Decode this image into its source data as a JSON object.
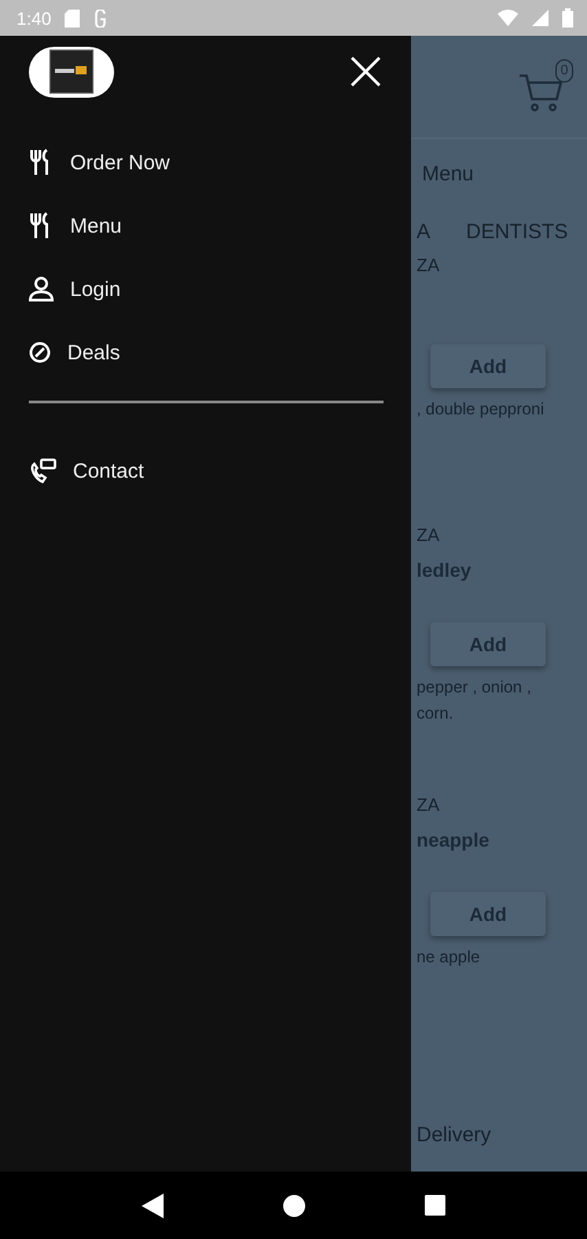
{
  "status_bar": {
    "time": "1:40"
  },
  "drawer": {
    "sections": [
      [
        {
          "label": "Order Now"
        },
        {
          "label": "Menu"
        },
        {
          "label": "Login"
        },
        {
          "label": "Deals"
        }
      ],
      [
        {
          "label": "Contact"
        }
      ]
    ]
  },
  "page": {
    "cart_count": "0",
    "menu_label": "Menu",
    "tabs": [
      {
        "label": "A"
      },
      {
        "label": "DENTISTS"
      }
    ],
    "products": [
      {
        "category": "ZA",
        "button": "Add",
        "description": [
          ", double pepproni"
        ]
      },
      {
        "category": "ZA",
        "name": "ledley",
        "button": "Add",
        "description": [
          "pepper , onion ,",
          "corn."
        ]
      },
      {
        "category": "ZA",
        "name": "neapple",
        "button": "Add",
        "description": [
          "ne apple"
        ]
      }
    ],
    "footer": "Delivery"
  }
}
